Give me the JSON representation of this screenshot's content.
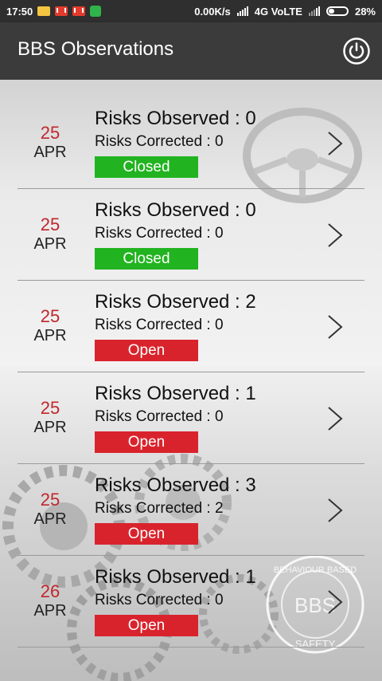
{
  "status_bar": {
    "time": "17:50",
    "network_speed": "0.00K/s",
    "network_type": "4G VoLTE",
    "battery": "28%"
  },
  "app_bar": {
    "title": "BBS Observations",
    "power_icon": "power-icon"
  },
  "observations": [
    {
      "day": "25",
      "month": "APR",
      "observed": "Risks Observed : 0",
      "corrected": "Risks Corrected : 0",
      "status": "Closed"
    },
    {
      "day": "25",
      "month": "APR",
      "observed": "Risks Observed : 0",
      "corrected": "Risks Corrected : 0",
      "status": "Closed"
    },
    {
      "day": "25",
      "month": "APR",
      "observed": "Risks Observed : 2",
      "corrected": "Risks Corrected : 0",
      "status": "Open"
    },
    {
      "day": "25",
      "month": "APR",
      "observed": "Risks Observed : 1",
      "corrected": "Risks Corrected : 0",
      "status": "Open"
    },
    {
      "day": "25",
      "month": "APR",
      "observed": "Risks Observed : 3",
      "corrected": "Risks Corrected : 2",
      "status": "Open"
    },
    {
      "day": "26",
      "month": "APR",
      "observed": "Risks Observed : 1",
      "corrected": "Risks Corrected : 0",
      "status": "Open"
    }
  ],
  "colors": {
    "app_bar": "#3b3b3b",
    "date_day": "#c0272d",
    "closed": "#22b320",
    "open": "#d9232c"
  },
  "logo": {
    "text_top": "BEHAVIOUR BASED",
    "text_center": "BBS",
    "text_bottom": "SAFETY"
  }
}
